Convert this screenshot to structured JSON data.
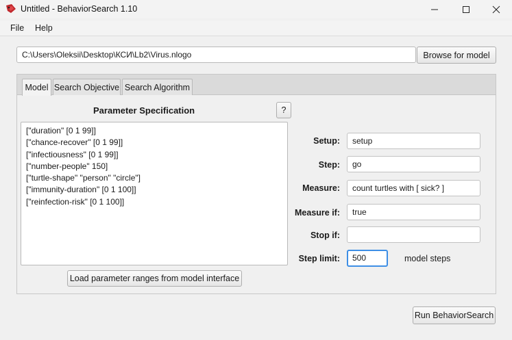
{
  "window": {
    "title": "Untitled - BehaviorSearch 1.10",
    "icon": "behaviorsearch-app-icon",
    "controls": [
      "minimize-icon",
      "maximize-icon",
      "close-icon"
    ]
  },
  "menu": {
    "items": [
      {
        "label": "File"
      },
      {
        "label": "Help"
      }
    ]
  },
  "model_path": {
    "value": "C:\\Users\\Oleksii\\Desktop\\КСИ\\Lb2\\Virus.nlogo",
    "browse_label": "Browse for model"
  },
  "tabs": [
    {
      "label": "Model",
      "active": true
    },
    {
      "label": "Search Objective",
      "active": false
    },
    {
      "label": "Search Algorithm",
      "active": false
    }
  ],
  "parameters": {
    "title": "Parameter Specification",
    "help_label": "?",
    "lines": [
      "[\"duration\" [0 1 99]]",
      "[\"chance-recover\" [0 1 99]]",
      "[\"infectiousness\" [0 1 99]]",
      "[\"number-people\" 150]",
      "[\"turtle-shape\" \"person\" \"circle\"]",
      "[\"immunity-duration\" [0 1 100]]",
      "[\"reinfection-risk\" [0 1 100]]"
    ],
    "load_button_label": "Load parameter ranges from model interface"
  },
  "fields": {
    "setup": {
      "label": "Setup:",
      "value": "setup"
    },
    "step": {
      "label": "Step:",
      "value": "go"
    },
    "measure": {
      "label": "Measure:",
      "value": "count turtles with [ sick? ]"
    },
    "measure_if": {
      "label": "Measure if:",
      "value": "true"
    },
    "stop_if": {
      "label": "Stop if:",
      "value": ""
    },
    "step_limit": {
      "label": "Step limit:",
      "value": "500",
      "unit": "model steps"
    }
  },
  "run_button_label": "Run BehaviorSearch",
  "colors": {
    "focus_border": "#3d8ee5",
    "icon_red": "#c0282d"
  }
}
